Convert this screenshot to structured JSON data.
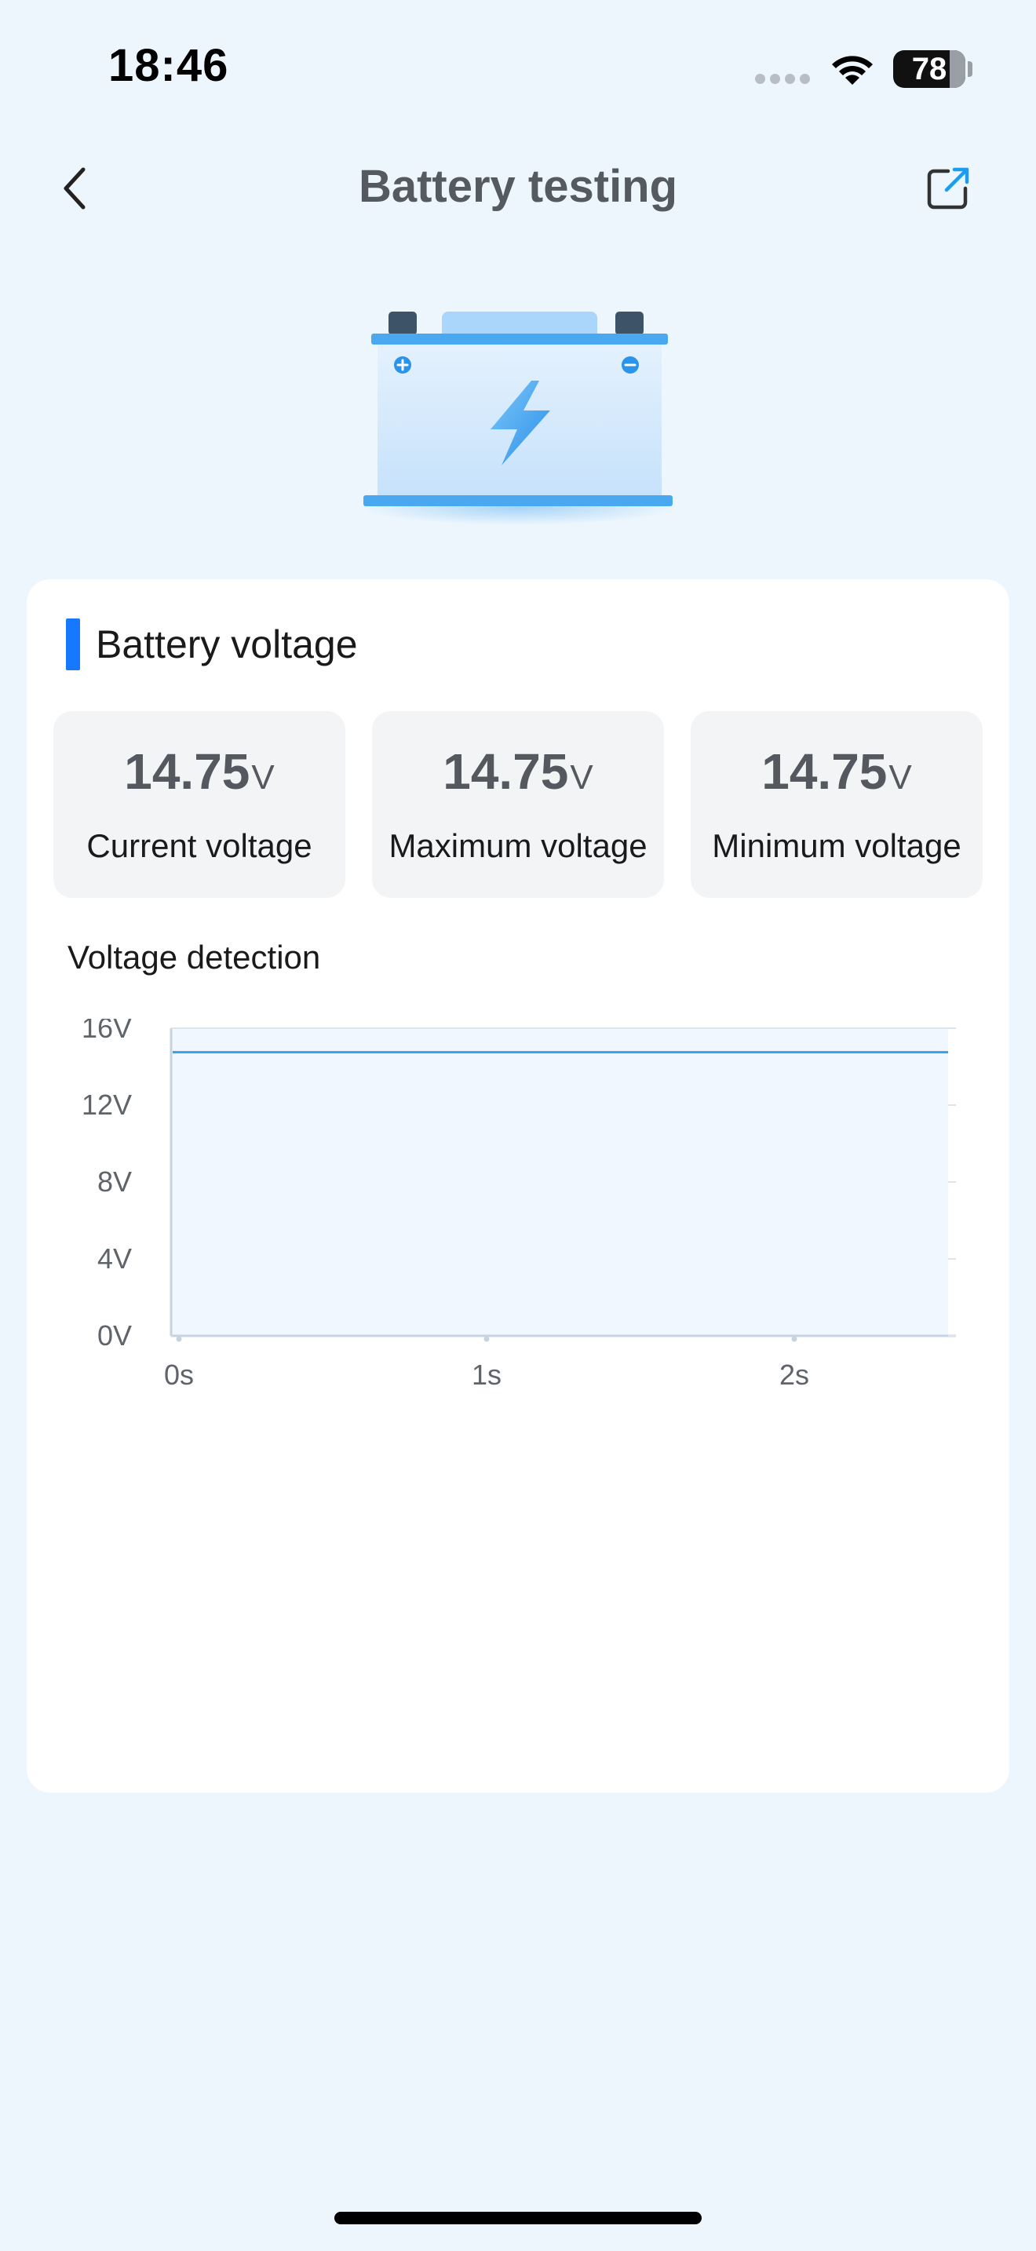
{
  "status_bar": {
    "time": "18:46",
    "battery_percent": "78",
    "battery_level": 0.78
  },
  "header": {
    "title": "Battery testing",
    "back_icon": "chevron-left-icon",
    "share_icon": "share-external-icon"
  },
  "illustration": {
    "icon": "car-battery-lightning-icon",
    "accent": "#4aa8f0"
  },
  "section": {
    "title": "Battery voltage",
    "accent": "#1677ff"
  },
  "stats": [
    {
      "value": "14.75",
      "unit": "V",
      "label": "Current voltage"
    },
    {
      "value": "14.75",
      "unit": "V",
      "label": "Maximum voltage"
    },
    {
      "value": "14.75",
      "unit": "V",
      "label": "Minimum voltage"
    }
  ],
  "chart": {
    "title": "Voltage detection"
  },
  "chart_data": {
    "type": "line",
    "title": "Voltage detection",
    "xlabel": "",
    "ylabel": "",
    "x_ticks": [
      "0s",
      "1s",
      "2s"
    ],
    "y_ticks": [
      "0V",
      "4V",
      "8V",
      "12V",
      "16V"
    ],
    "ylim": [
      0,
      16
    ],
    "xlim": [
      0,
      2.5
    ],
    "grid": false,
    "series": [
      {
        "x": [
          0,
          2.5
        ],
        "values": [
          14.75,
          14.75
        ],
        "color": "#3b9ee8"
      }
    ]
  }
}
